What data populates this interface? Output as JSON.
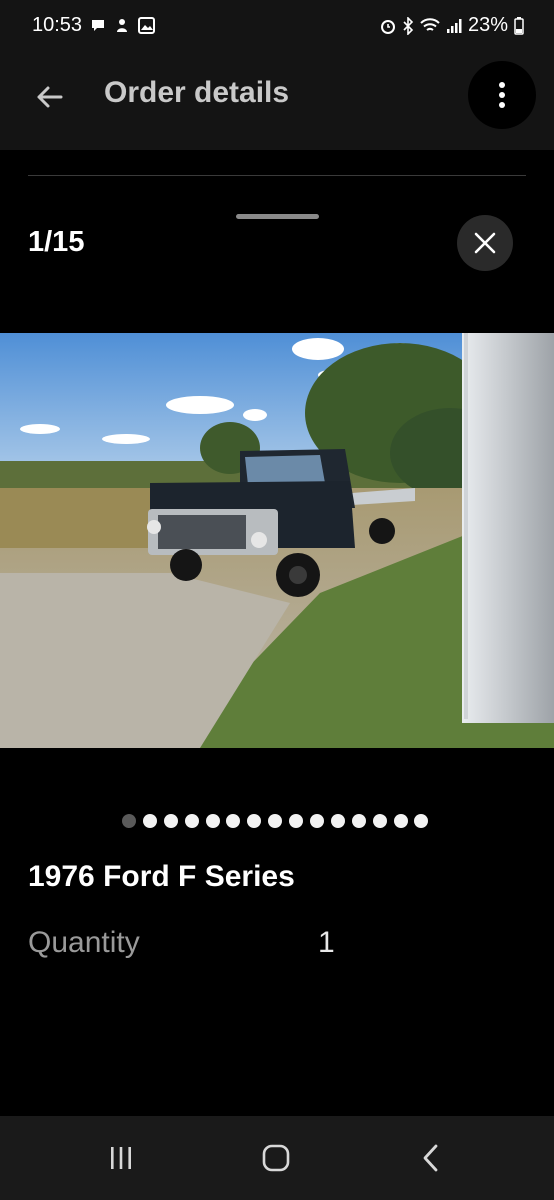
{
  "status_bar": {
    "time": "10:53",
    "battery": "23%",
    "left_icons": [
      "chat-bubble-icon",
      "notification-icon",
      "image-icon"
    ],
    "right_icons": [
      "alarm-icon",
      "bluetooth-icon",
      "wifi-icon",
      "signal-icon",
      "battery-icon"
    ]
  },
  "app_bar": {
    "title": "Order details",
    "back_icon": "arrow-left-icon",
    "menu_icon": "more-vertical-icon"
  },
  "gallery": {
    "counter": "1/15",
    "close_icon": "close-icon",
    "total_images": 15,
    "active_index": 0
  },
  "product": {
    "title": "1976 Ford F Series",
    "quantity_label": "Quantity",
    "quantity_value": "1"
  },
  "nav_bar": {
    "buttons": [
      "recents-icon",
      "home-icon",
      "back-icon"
    ]
  },
  "colors": {
    "background": "#000000",
    "bar": "#141414",
    "title_text": "#c9c9c9",
    "muted_text": "#9a9a9a"
  }
}
